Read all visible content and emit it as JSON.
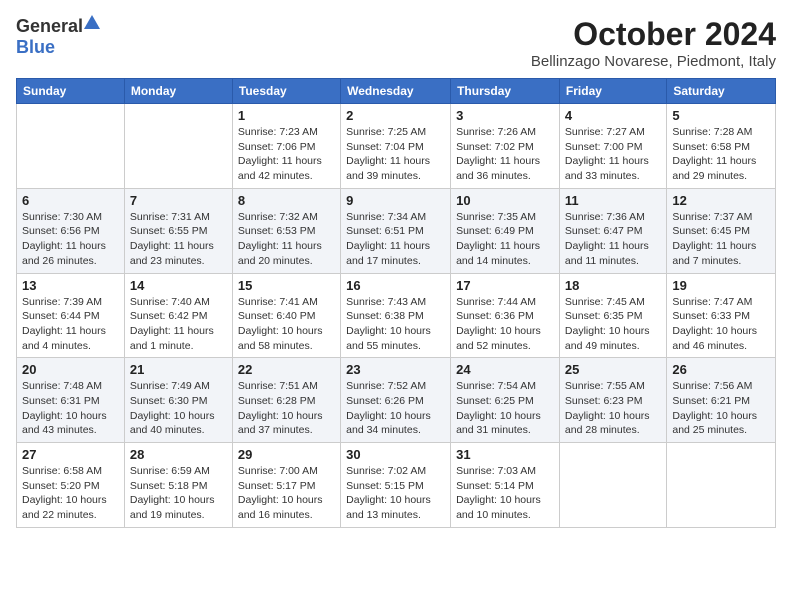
{
  "header": {
    "logo_general": "General",
    "logo_blue": "Blue",
    "month": "October 2024",
    "location": "Bellinzago Novarese, Piedmont, Italy"
  },
  "days_of_week": [
    "Sunday",
    "Monday",
    "Tuesday",
    "Wednesday",
    "Thursday",
    "Friday",
    "Saturday"
  ],
  "weeks": [
    [
      {
        "day": "",
        "info": ""
      },
      {
        "day": "",
        "info": ""
      },
      {
        "day": "1",
        "info": "Sunrise: 7:23 AM\nSunset: 7:06 PM\nDaylight: 11 hours and 42 minutes."
      },
      {
        "day": "2",
        "info": "Sunrise: 7:25 AM\nSunset: 7:04 PM\nDaylight: 11 hours and 39 minutes."
      },
      {
        "day": "3",
        "info": "Sunrise: 7:26 AM\nSunset: 7:02 PM\nDaylight: 11 hours and 36 minutes."
      },
      {
        "day": "4",
        "info": "Sunrise: 7:27 AM\nSunset: 7:00 PM\nDaylight: 11 hours and 33 minutes."
      },
      {
        "day": "5",
        "info": "Sunrise: 7:28 AM\nSunset: 6:58 PM\nDaylight: 11 hours and 29 minutes."
      }
    ],
    [
      {
        "day": "6",
        "info": "Sunrise: 7:30 AM\nSunset: 6:56 PM\nDaylight: 11 hours and 26 minutes."
      },
      {
        "day": "7",
        "info": "Sunrise: 7:31 AM\nSunset: 6:55 PM\nDaylight: 11 hours and 23 minutes."
      },
      {
        "day": "8",
        "info": "Sunrise: 7:32 AM\nSunset: 6:53 PM\nDaylight: 11 hours and 20 minutes."
      },
      {
        "day": "9",
        "info": "Sunrise: 7:34 AM\nSunset: 6:51 PM\nDaylight: 11 hours and 17 minutes."
      },
      {
        "day": "10",
        "info": "Sunrise: 7:35 AM\nSunset: 6:49 PM\nDaylight: 11 hours and 14 minutes."
      },
      {
        "day": "11",
        "info": "Sunrise: 7:36 AM\nSunset: 6:47 PM\nDaylight: 11 hours and 11 minutes."
      },
      {
        "day": "12",
        "info": "Sunrise: 7:37 AM\nSunset: 6:45 PM\nDaylight: 11 hours and 7 minutes."
      }
    ],
    [
      {
        "day": "13",
        "info": "Sunrise: 7:39 AM\nSunset: 6:44 PM\nDaylight: 11 hours and 4 minutes."
      },
      {
        "day": "14",
        "info": "Sunrise: 7:40 AM\nSunset: 6:42 PM\nDaylight: 11 hours and 1 minute."
      },
      {
        "day": "15",
        "info": "Sunrise: 7:41 AM\nSunset: 6:40 PM\nDaylight: 10 hours and 58 minutes."
      },
      {
        "day": "16",
        "info": "Sunrise: 7:43 AM\nSunset: 6:38 PM\nDaylight: 10 hours and 55 minutes."
      },
      {
        "day": "17",
        "info": "Sunrise: 7:44 AM\nSunset: 6:36 PM\nDaylight: 10 hours and 52 minutes."
      },
      {
        "day": "18",
        "info": "Sunrise: 7:45 AM\nSunset: 6:35 PM\nDaylight: 10 hours and 49 minutes."
      },
      {
        "day": "19",
        "info": "Sunrise: 7:47 AM\nSunset: 6:33 PM\nDaylight: 10 hours and 46 minutes."
      }
    ],
    [
      {
        "day": "20",
        "info": "Sunrise: 7:48 AM\nSunset: 6:31 PM\nDaylight: 10 hours and 43 minutes."
      },
      {
        "day": "21",
        "info": "Sunrise: 7:49 AM\nSunset: 6:30 PM\nDaylight: 10 hours and 40 minutes."
      },
      {
        "day": "22",
        "info": "Sunrise: 7:51 AM\nSunset: 6:28 PM\nDaylight: 10 hours and 37 minutes."
      },
      {
        "day": "23",
        "info": "Sunrise: 7:52 AM\nSunset: 6:26 PM\nDaylight: 10 hours and 34 minutes."
      },
      {
        "day": "24",
        "info": "Sunrise: 7:54 AM\nSunset: 6:25 PM\nDaylight: 10 hours and 31 minutes."
      },
      {
        "day": "25",
        "info": "Sunrise: 7:55 AM\nSunset: 6:23 PM\nDaylight: 10 hours and 28 minutes."
      },
      {
        "day": "26",
        "info": "Sunrise: 7:56 AM\nSunset: 6:21 PM\nDaylight: 10 hours and 25 minutes."
      }
    ],
    [
      {
        "day": "27",
        "info": "Sunrise: 6:58 AM\nSunset: 5:20 PM\nDaylight: 10 hours and 22 minutes."
      },
      {
        "day": "28",
        "info": "Sunrise: 6:59 AM\nSunset: 5:18 PM\nDaylight: 10 hours and 19 minutes."
      },
      {
        "day": "29",
        "info": "Sunrise: 7:00 AM\nSunset: 5:17 PM\nDaylight: 10 hours and 16 minutes."
      },
      {
        "day": "30",
        "info": "Sunrise: 7:02 AM\nSunset: 5:15 PM\nDaylight: 10 hours and 13 minutes."
      },
      {
        "day": "31",
        "info": "Sunrise: 7:03 AM\nSunset: 5:14 PM\nDaylight: 10 hours and 10 minutes."
      },
      {
        "day": "",
        "info": ""
      },
      {
        "day": "",
        "info": ""
      }
    ]
  ]
}
